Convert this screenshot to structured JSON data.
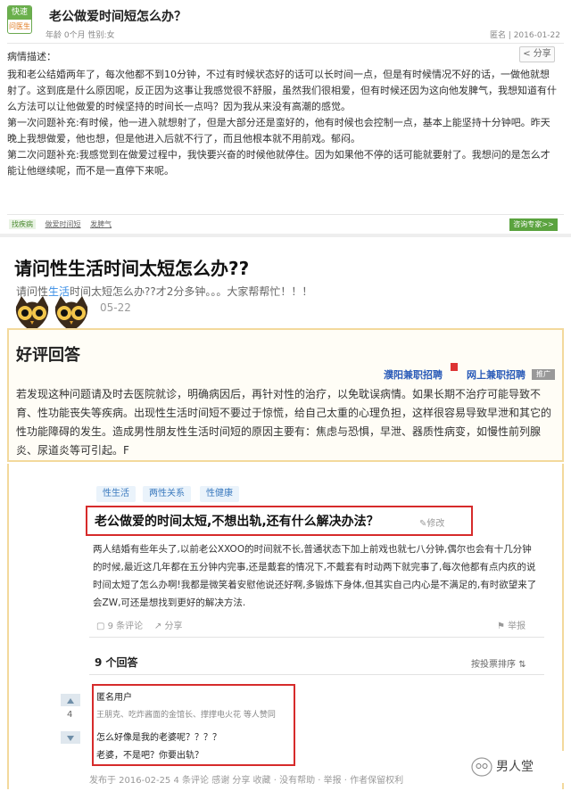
{
  "s1": {
    "badge_top": "快速",
    "badge_bottom": "问医生",
    "title": "老公做爱时间短怎么办？",
    "meta": "年龄 0个月 性别:女",
    "date": "匿名 | 2016-01-22",
    "share": "分享",
    "desc_label": "病情描述：",
    "body": [
      "我和老公结婚两年了，每次他都不到10分钟，不过有时候状态好的话可以长时间一点，但是有时候情况不好的话，一做他就想射了。这到底是什么原因呢，反正因为这事让我感觉很不舒服，虽然我们很相爱，但有时候还因为这向他发脾气，我想知道有什么方法可以让他做爱的时候坚持的时间长一点吗？因为我从来没有高潮的感觉。",
      "第一次问题补充:有时候，他一进入就想射了，但是大部分还是蛮好的，他有时候也会控制一点，基本上能坚持十分钟吧。昨天晚上我想做爱，他也想，但是他进入后就不行了，而且他根本就不用前戏。郁闷。",
      "第二次问题补充:我感觉到在做爱过程中，我快要兴奋的时候他就停住。因为如果他不停的话可能就要射了。我想问的是怎么才能让他继续呢，而不是一直停下来呢。"
    ],
    "tags": [
      "找疾病",
      "做爱时间短",
      "发脾气"
    ],
    "expert_button": "咨询专家>>"
  },
  "s2": {
    "title": "请问性生活时间太短怎么办??",
    "sub_pre": "请问性",
    "sub_hl": "生活",
    "sub_post": "时间太短怎么办??才2分多钟。。。大家帮帮忙！！！",
    "date": "05-22",
    "good_title": "好评回答",
    "ad1": "濮阳兼职招聘",
    "ad2": "网上兼职招聘",
    "ad_tag": "推广",
    "good_body": "若发现这种问题请及时去医院就诊，明确病因后，再针对性的治疗，以免耽误病情。如果长期不治疗可能导致不育、性功能丧失等疾病。出现性生活时间短不要过于惊慌，给自己太重的心理负担，这样很容易导致早泄和其它的性功能障碍的发生。造成男性朋友性生活时间短的原因主要有：焦虑与恐惧，早泄、器质性病变，如慢性前列腺炎、尿道炎等可引起。F"
  },
  "s3": {
    "chips": [
      "性生活",
      "两性关系",
      "性健康"
    ],
    "q_title": "老公做爱的时间太短,不想出轨,还有什么解决办法？",
    "q_edit": "修改",
    "q_body": "两人结婚有些年头了,以前老公XXOO的时间就不长,普通状态下加上前戏也就七八分钟,偶尔也会有十几分钟的时候,最近这几年都在五分钟内完事,还是戴套的情况下,不戴套有时动两下就完事了,每次他都有点内疚的说时间太短了怎么办啊!我都是微笑着安慰他说还好啊,多锻炼下身体,但其实自己内心是不满足的,有时欲望来了会ZW,可还是想找到更好的解决方法.",
    "comments": "9 条评论",
    "share": "分享",
    "report": "举报",
    "answers_count": "9 个回答",
    "sort": "按投票排序",
    "vote": "4",
    "ans_user": "匿名用户",
    "ans_voters": "王朋克、吃炸酱面的金馆长、撑撑电火花 等人赞同",
    "ans_t1": "怎么好像是我的老婆呢？？？？",
    "ans_t2": "老婆，不是吧？你要出轨？",
    "footer": "发布于 2016-02-25   4 条评论   感谢   分享   收藏 · 没有帮助 · 举报 · 作者保留权利"
  },
  "watermark": {
    "text": "男人堂",
    "icon": "owl-circle-icon"
  },
  "colors": {
    "highlight_red": "#d62b2b",
    "accent_green": "#5ba33f",
    "panel_border": "#f3d99c",
    "link_blue": "#2a5bb8"
  }
}
